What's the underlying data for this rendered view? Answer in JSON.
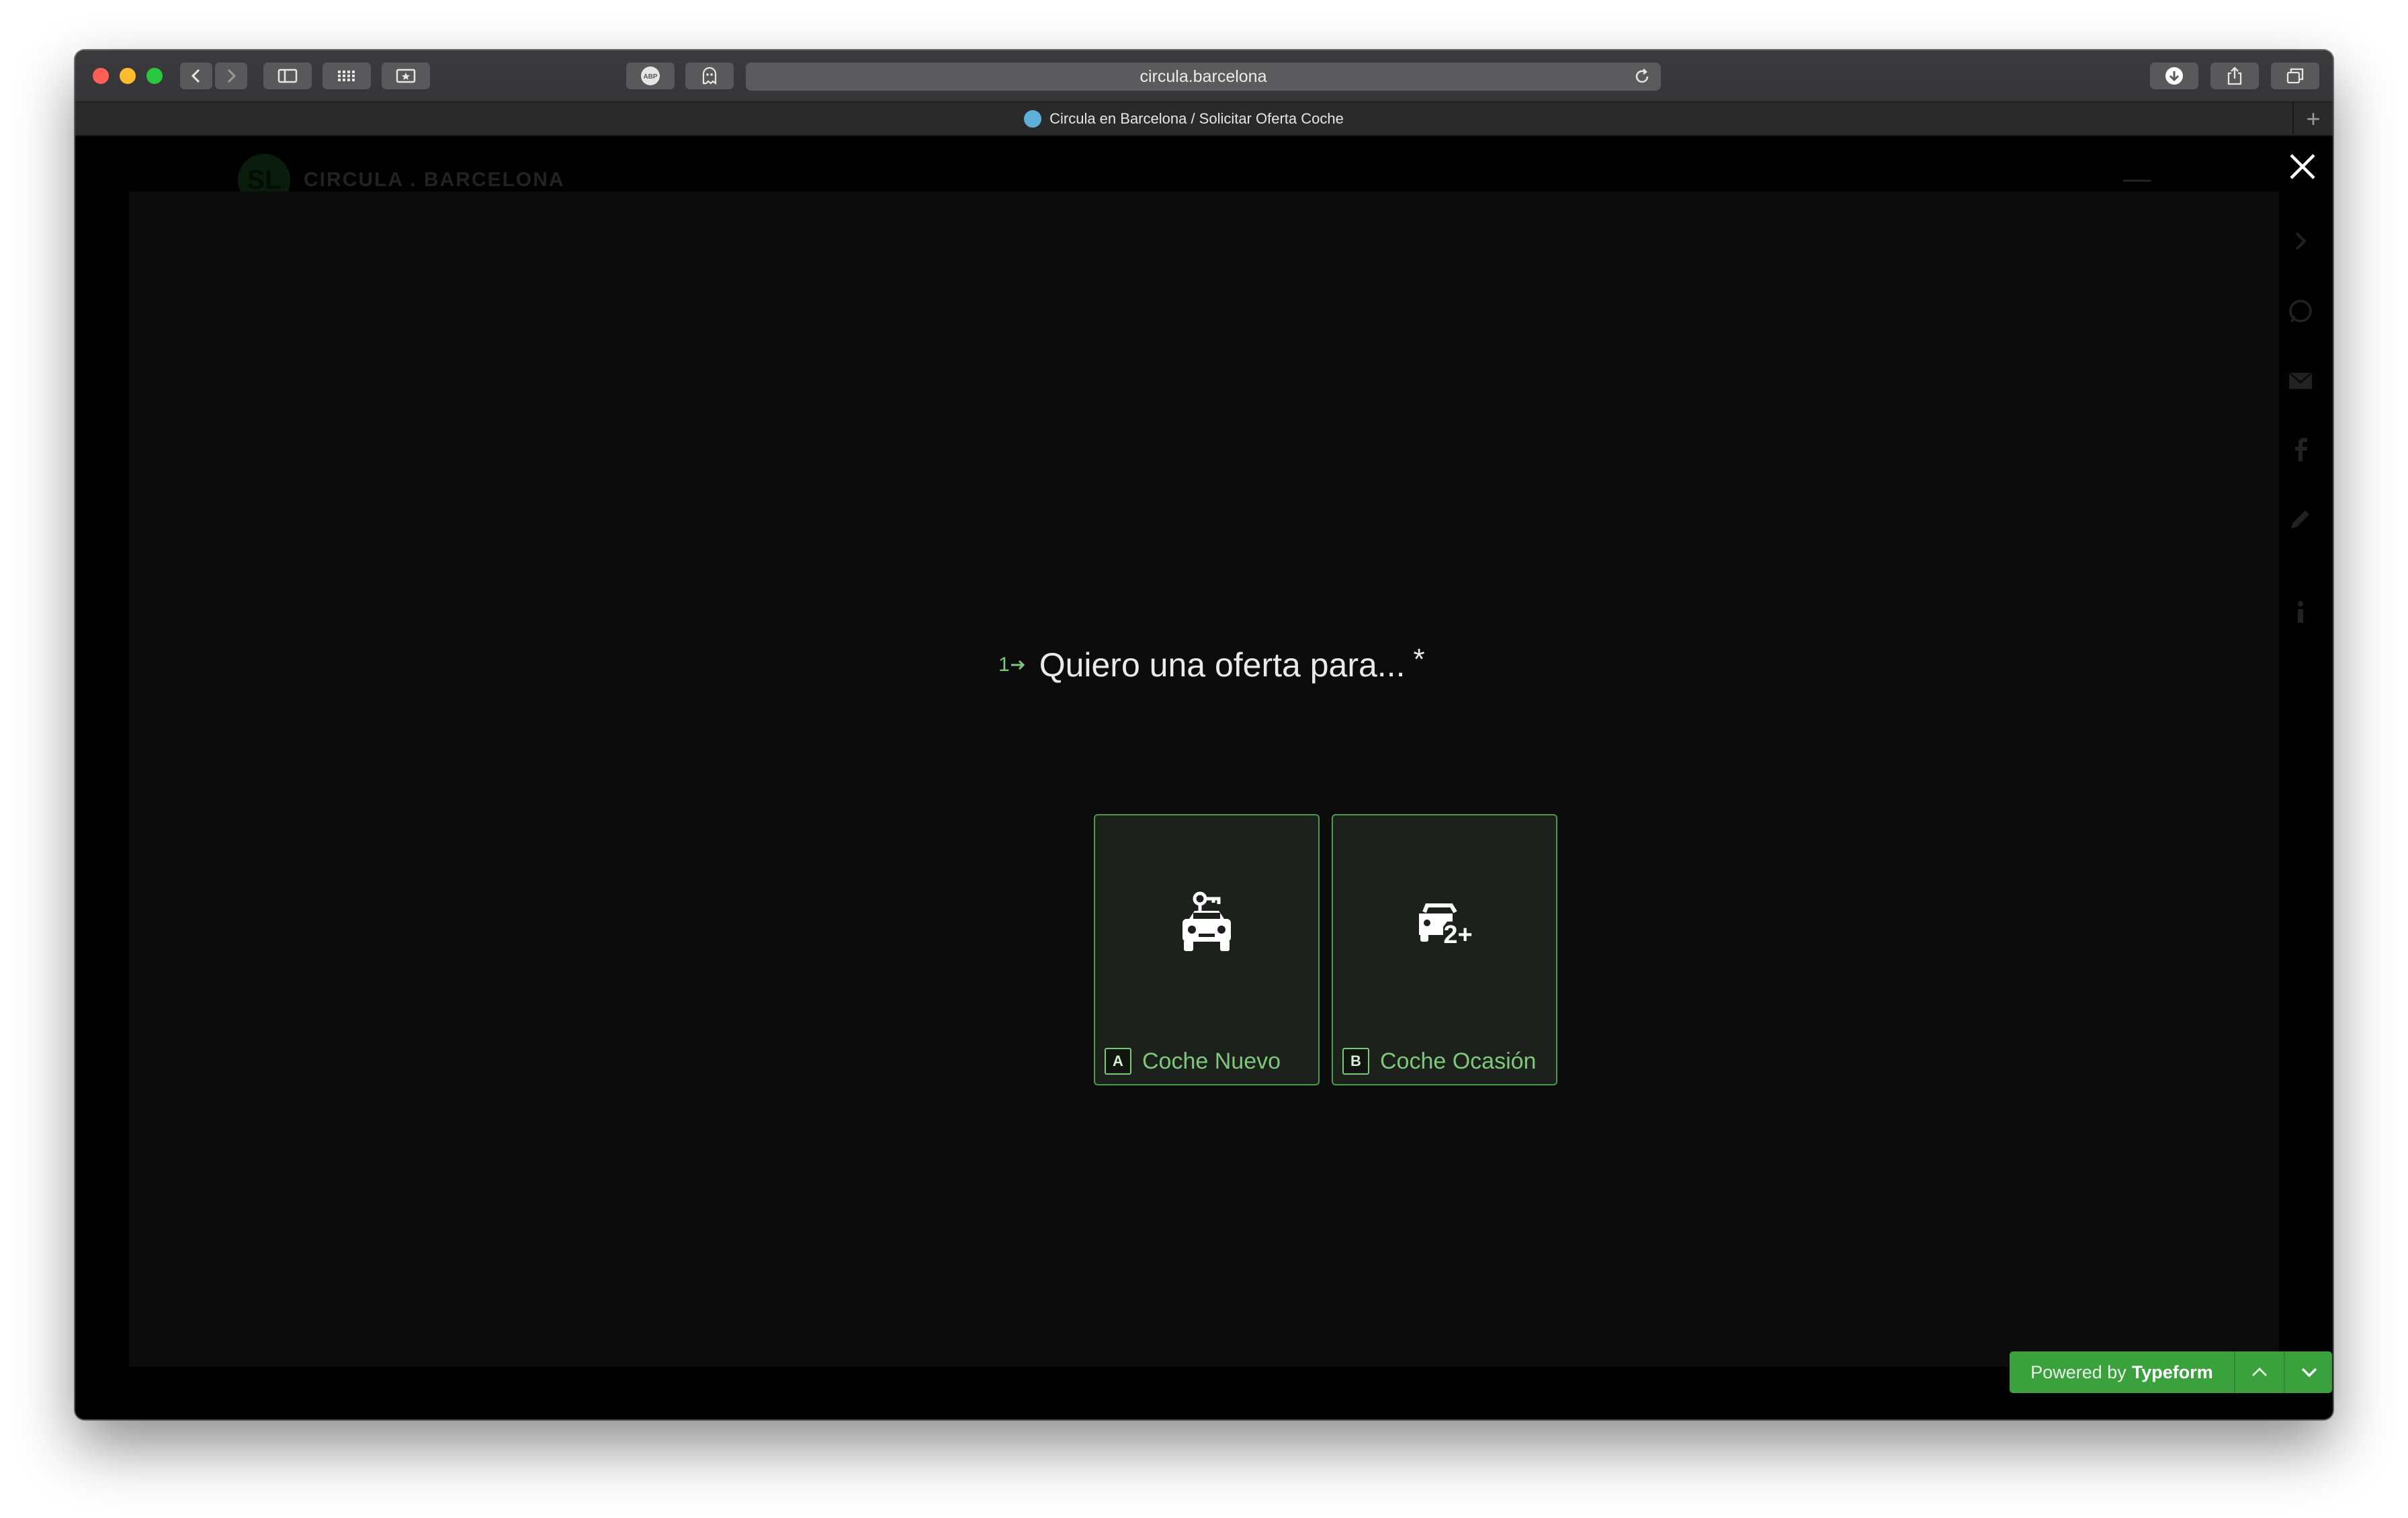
{
  "browser": {
    "url": "circula.barcelona",
    "tab_title": "Circula en Barcelona / Solicitar Oferta Coche",
    "new_tab_symbol": "+"
  },
  "site": {
    "logo_mark": "SL",
    "logo_text": "CIRCULA . BARCELONA"
  },
  "form": {
    "question_number": "1",
    "question_text": "Quiero una oferta para...",
    "required_marker": "*",
    "choices": [
      {
        "key": "A",
        "label": "Coche Nuevo",
        "icon": "new-car-key-icon"
      },
      {
        "key": "B",
        "label": "Coche Ocasión",
        "icon": "used-car-2plus-icon"
      }
    ]
  },
  "typeform_bar": {
    "powered_prefix": "Powered by",
    "brand": "Typeform"
  },
  "colors": {
    "accent": "#7ec87b",
    "choice_border": "#4c9a4e",
    "typeform_green": "#3aa13c",
    "modal_bg": "#0c0c0c"
  }
}
